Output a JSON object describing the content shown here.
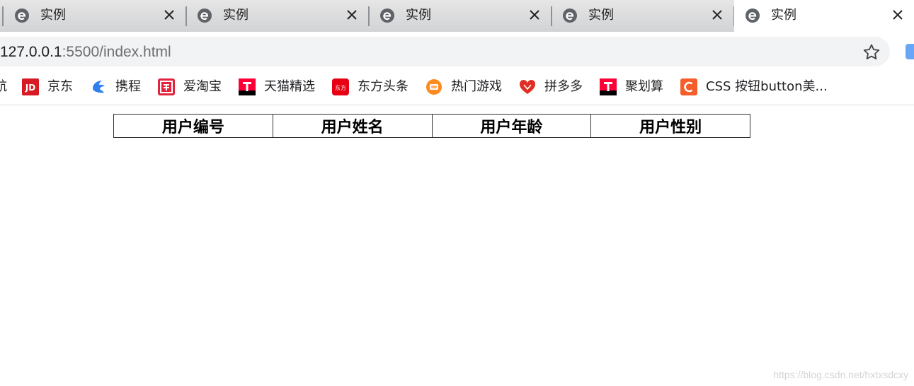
{
  "tabs": [
    {
      "title": "实例",
      "favicon": "edge-e-icon",
      "active": false
    },
    {
      "title": "实例",
      "favicon": "edge-e-icon",
      "active": false
    },
    {
      "title": "实例",
      "favicon": "edge-e-icon",
      "active": false
    },
    {
      "title": "实例",
      "favicon": "edge-e-icon",
      "active": false
    },
    {
      "title": "实例",
      "favicon": "edge-e-icon",
      "active": true
    }
  ],
  "address_bar": {
    "url_host": "127.0.0.1",
    "url_rest": ":5500/index.html"
  },
  "bookmarks": {
    "cut_label": "航",
    "items": [
      {
        "label": "京东",
        "icon": "jd-icon",
        "color": "#d71a23"
      },
      {
        "label": "携程",
        "icon": "ctrip-icon",
        "color": "#2f80ed"
      },
      {
        "label": "爱淘宝",
        "icon": "taobao-icon",
        "color": "#e2233e"
      },
      {
        "label": "天猫精选",
        "icon": "tmall-icon",
        "color": "#ff0036"
      },
      {
        "label": "东方头条",
        "icon": "dftt-icon",
        "color": "#e60012"
      },
      {
        "label": "热门游戏",
        "icon": "game-icon",
        "color": "#ff8a1f"
      },
      {
        "label": "拼多多",
        "icon": "pinduoduo-icon",
        "color": "#e02e24"
      },
      {
        "label": "聚划算",
        "icon": "juhuasuan-icon",
        "color": "#ff0036"
      },
      {
        "label": "CSS 按钮button美...",
        "icon": "csdn-icon",
        "color": "#f55e2a"
      }
    ]
  },
  "table": {
    "headers": [
      "用户编号",
      "用户姓名",
      "用户年龄",
      "用户性别"
    ]
  },
  "watermark": "https://blog.csdn.net/hxtxsdcxy"
}
